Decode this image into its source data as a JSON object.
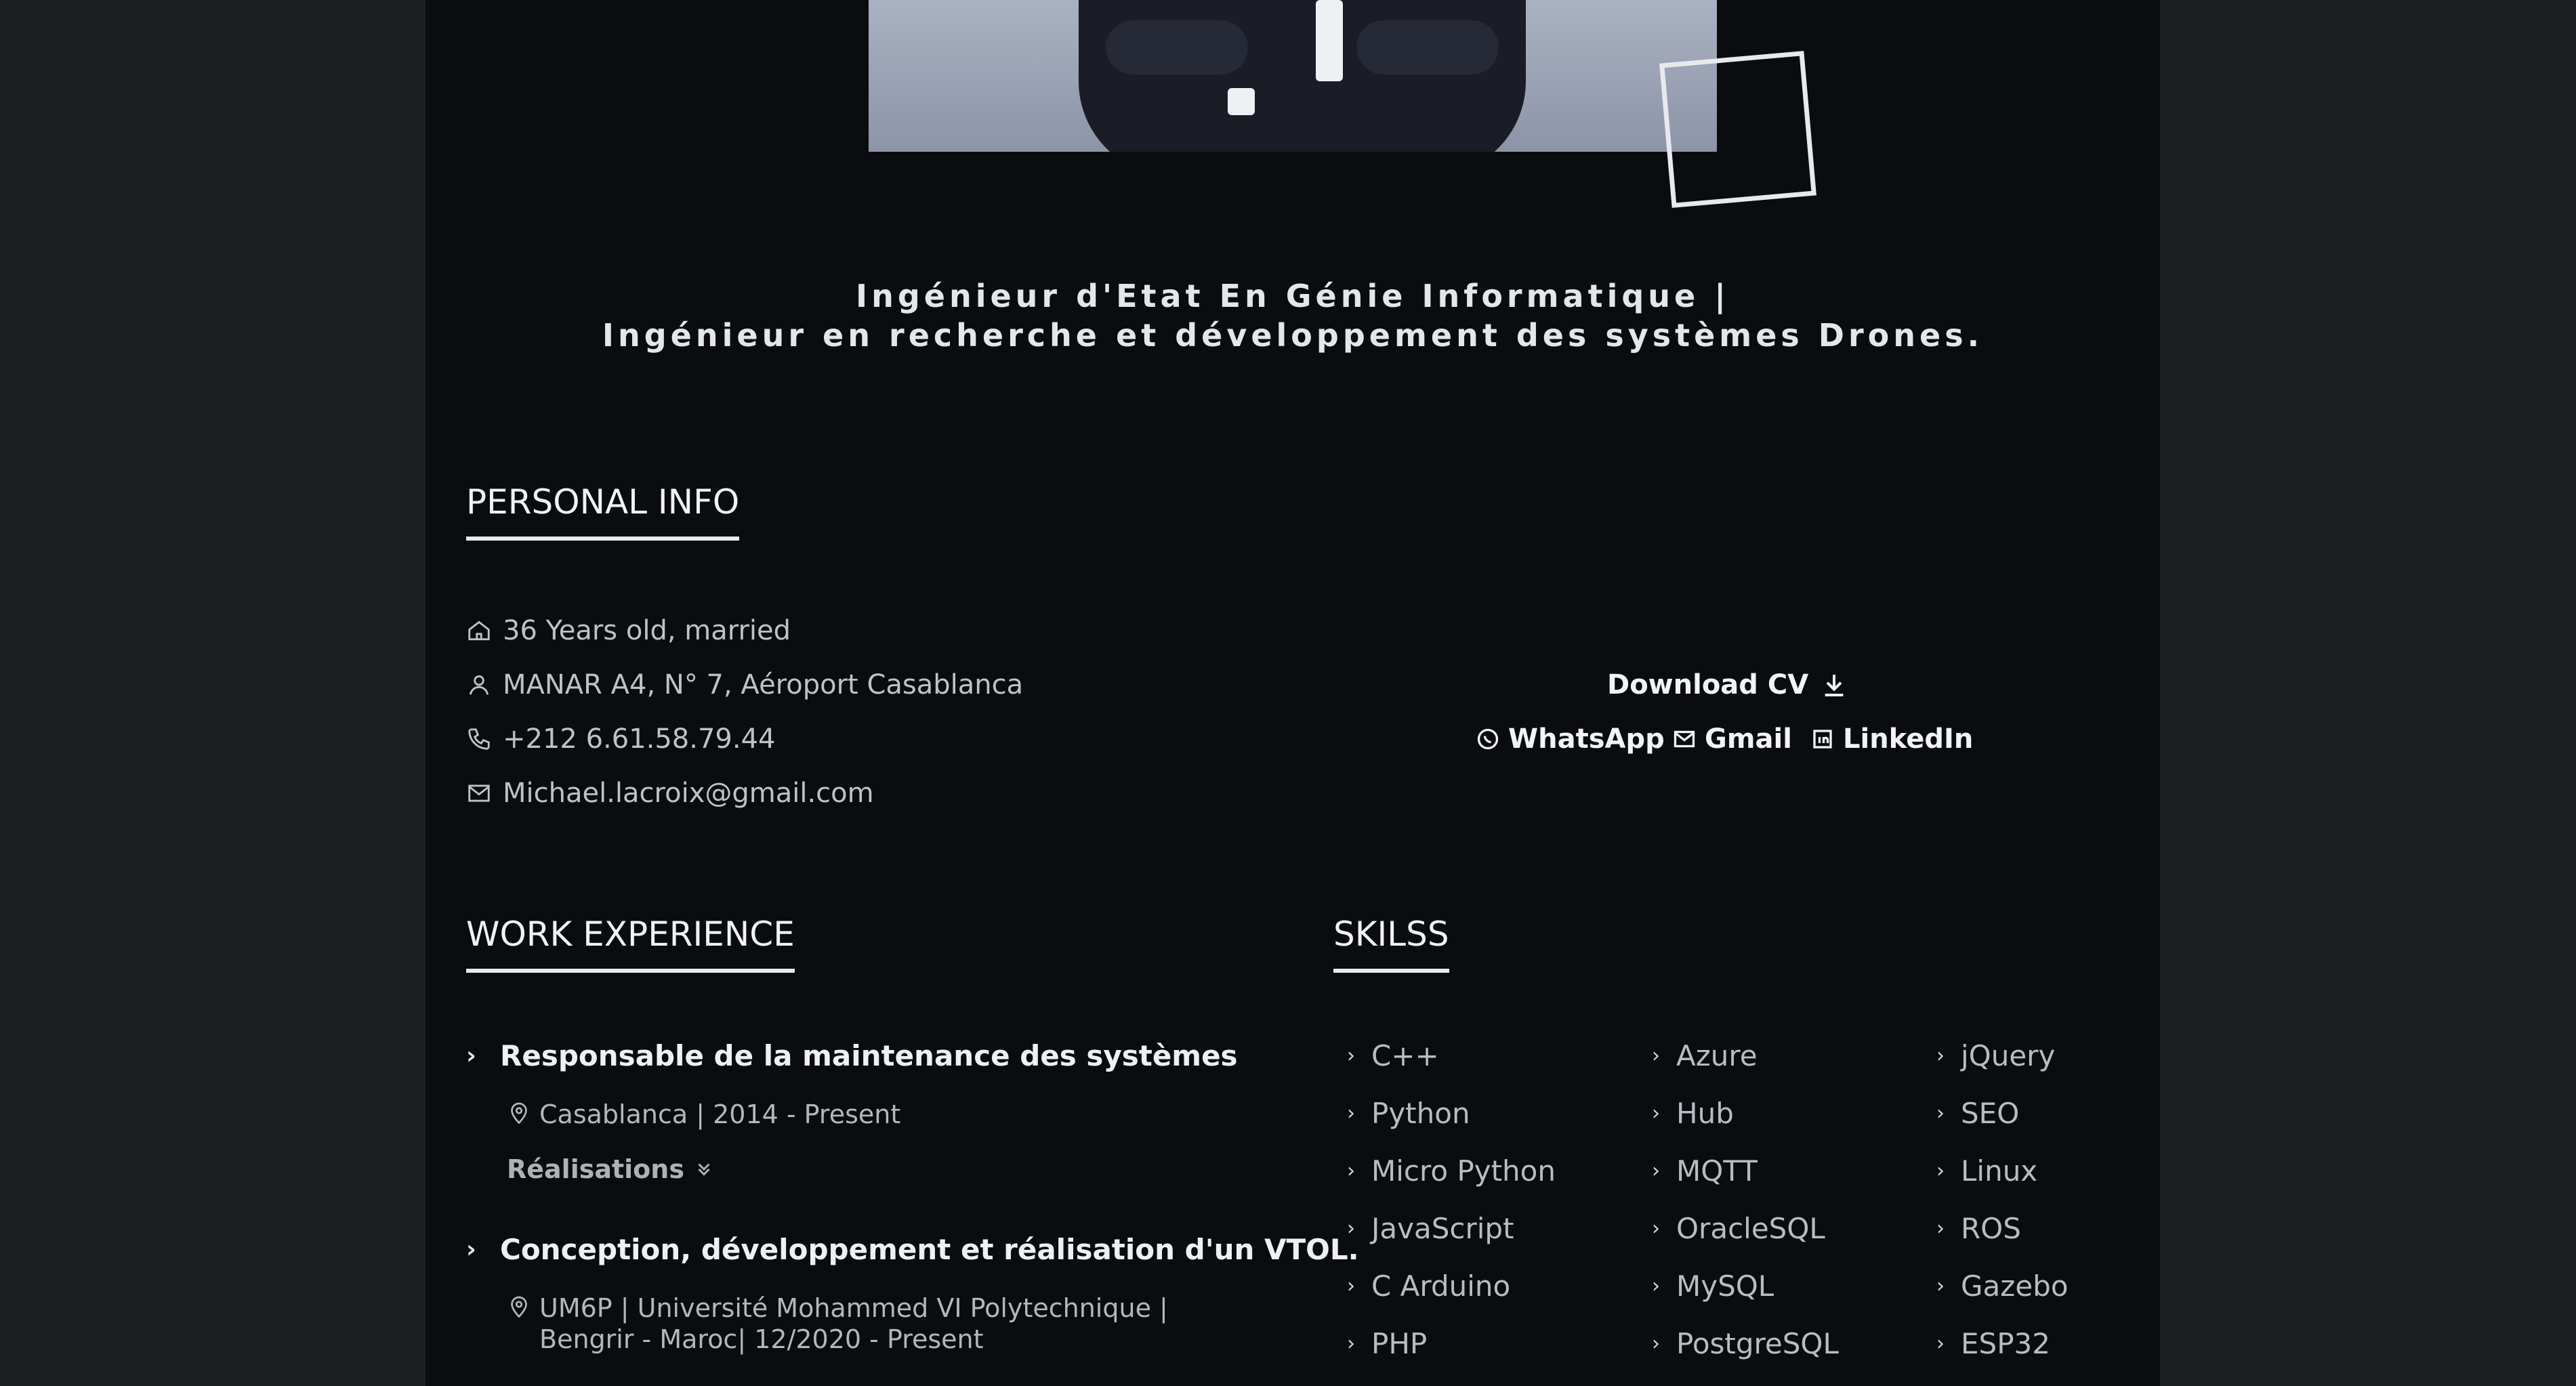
{
  "headline": {
    "line1": "Ingénieur d'Etat En Génie Informatique |",
    "line2": "Ingénieur en recherche et développement des systèmes Drones."
  },
  "personal_info": {
    "title": "PERSONAL INFO",
    "items": [
      {
        "icon": "home-icon",
        "text": "36 Years old, married"
      },
      {
        "icon": "user-icon",
        "text": "MANAR A4, N° 7, Aéroport Casablanca"
      },
      {
        "icon": "phone-icon",
        "text": "+212 6.61.58.79.44"
      },
      {
        "icon": "mail-icon",
        "text": "Michael.lacroix@gmail.com"
      }
    ],
    "download_cv": "Download CV",
    "links": {
      "whatsapp": "WhatsApp",
      "gmail": "Gmail",
      "linkedin": "LinkedIn"
    }
  },
  "work_experience": {
    "title": "WORK EXPERIENCE",
    "jobs": [
      {
        "title": "Responsable de la maintenance des systèmes",
        "meta": "Casablanca | 2014 - Present",
        "toggle": "Réalisations"
      },
      {
        "title": "Conception, développement et réalisation d'un VTOL.",
        "meta_line1": "UM6P | Université Mohammed VI Polytechnique |",
        "meta_line2": "Bengrir - Maroc| 12/2020 - Present"
      }
    ]
  },
  "skills": {
    "title": "SKILSS",
    "col1": [
      "C++",
      "Python",
      "Micro Python",
      "JavaScript",
      "C Arduino",
      "PHP"
    ],
    "col2": [
      "Azure",
      "Hub",
      "MQTT",
      "OracleSQL",
      "MySQL",
      "PostgreSQL"
    ],
    "col3": [
      "jQuery",
      "SEO",
      "Linux",
      "ROS",
      "Gazebo",
      "ESP32"
    ]
  },
  "colors": {
    "background": "#0b0c0f",
    "side": "#1c1e22",
    "text": "#c9cbd0",
    "accent": "#e9eaee"
  }
}
